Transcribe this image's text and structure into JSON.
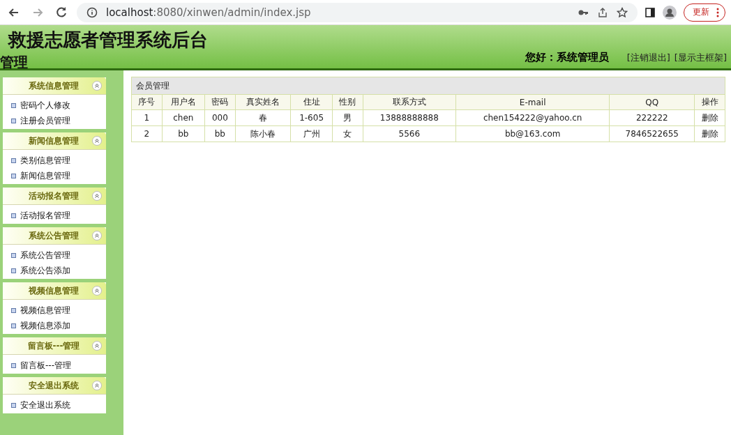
{
  "browser": {
    "url_host": "localhost",
    "url_rest": ":8080/xinwen/admin/index.jsp",
    "update_button": "更新"
  },
  "header": {
    "title": "救援志愿者管理系统后台",
    "greeting": "您好：系统管理员",
    "links": [
      "[注销退出]",
      "[显示主框架]"
    ],
    "overflow_text": "管理"
  },
  "sidebar": {
    "groups": [
      {
        "title": "系统信息管理",
        "items": [
          "密码个人修改",
          "注册会员管理"
        ]
      },
      {
        "title": "新闻信息管理",
        "items": [
          "类别信息管理",
          "新闻信息管理"
        ]
      },
      {
        "title": "活动报名管理",
        "items": [
          "活动报名管理"
        ]
      },
      {
        "title": "系统公告管理",
        "items": [
          "系统公告管理",
          "系统公告添加"
        ]
      },
      {
        "title": "视频信息管理",
        "items": [
          "视频信息管理",
          "视频信息添加"
        ]
      },
      {
        "title": "留言板---管理",
        "items": [
          "留言板---管理"
        ]
      },
      {
        "title": "安全退出系统",
        "items": [
          "安全退出系统"
        ]
      }
    ]
  },
  "table": {
    "title": "会员管理",
    "columns": [
      "序号",
      "用户名",
      "密码",
      "真实姓名",
      "住址",
      "性别",
      "联系方式",
      "E-mail",
      "QQ",
      "操作"
    ],
    "rows": [
      [
        "1",
        "chen",
        "000",
        "春",
        "1-605",
        "男",
        "13888888888",
        "chen154222@yahoo.cn",
        "222222",
        "删除"
      ],
      [
        "2",
        "bb",
        "bb",
        "陈小春",
        "广州",
        "女",
        "5566",
        "bb@163.com",
        "7846522655",
        "删除"
      ]
    ]
  }
}
